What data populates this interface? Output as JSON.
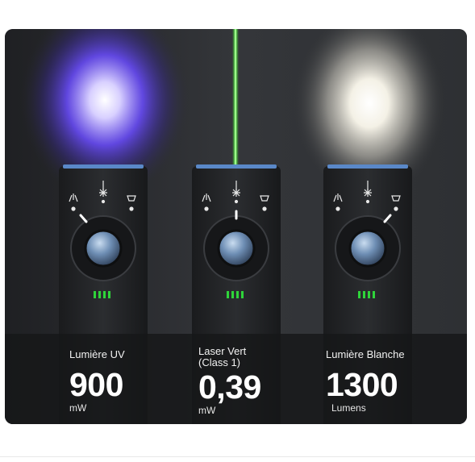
{
  "colors": {
    "panel_background": "#2a2c30",
    "info_band": "#1c1d1f",
    "uv_light": "#6a4cff",
    "laser_green": "#39e62a",
    "white_light": "#f4f1e6",
    "battery_led": "#2fd43a"
  },
  "icons": [
    "uv-mode-icon",
    "laser-mode-icon",
    "white-light-mode-icon"
  ],
  "products": [
    {
      "mode": "uv",
      "label": "Lumière UV",
      "value": "900",
      "unit": "mW"
    },
    {
      "mode": "laser",
      "label_line1": "Laser Vert",
      "label_line2": "(Class 1)",
      "value": "0,39",
      "unit": "mW"
    },
    {
      "mode": "white",
      "label": "Lumière Blanche",
      "value": "1300",
      "unit": "Lumens"
    }
  ]
}
